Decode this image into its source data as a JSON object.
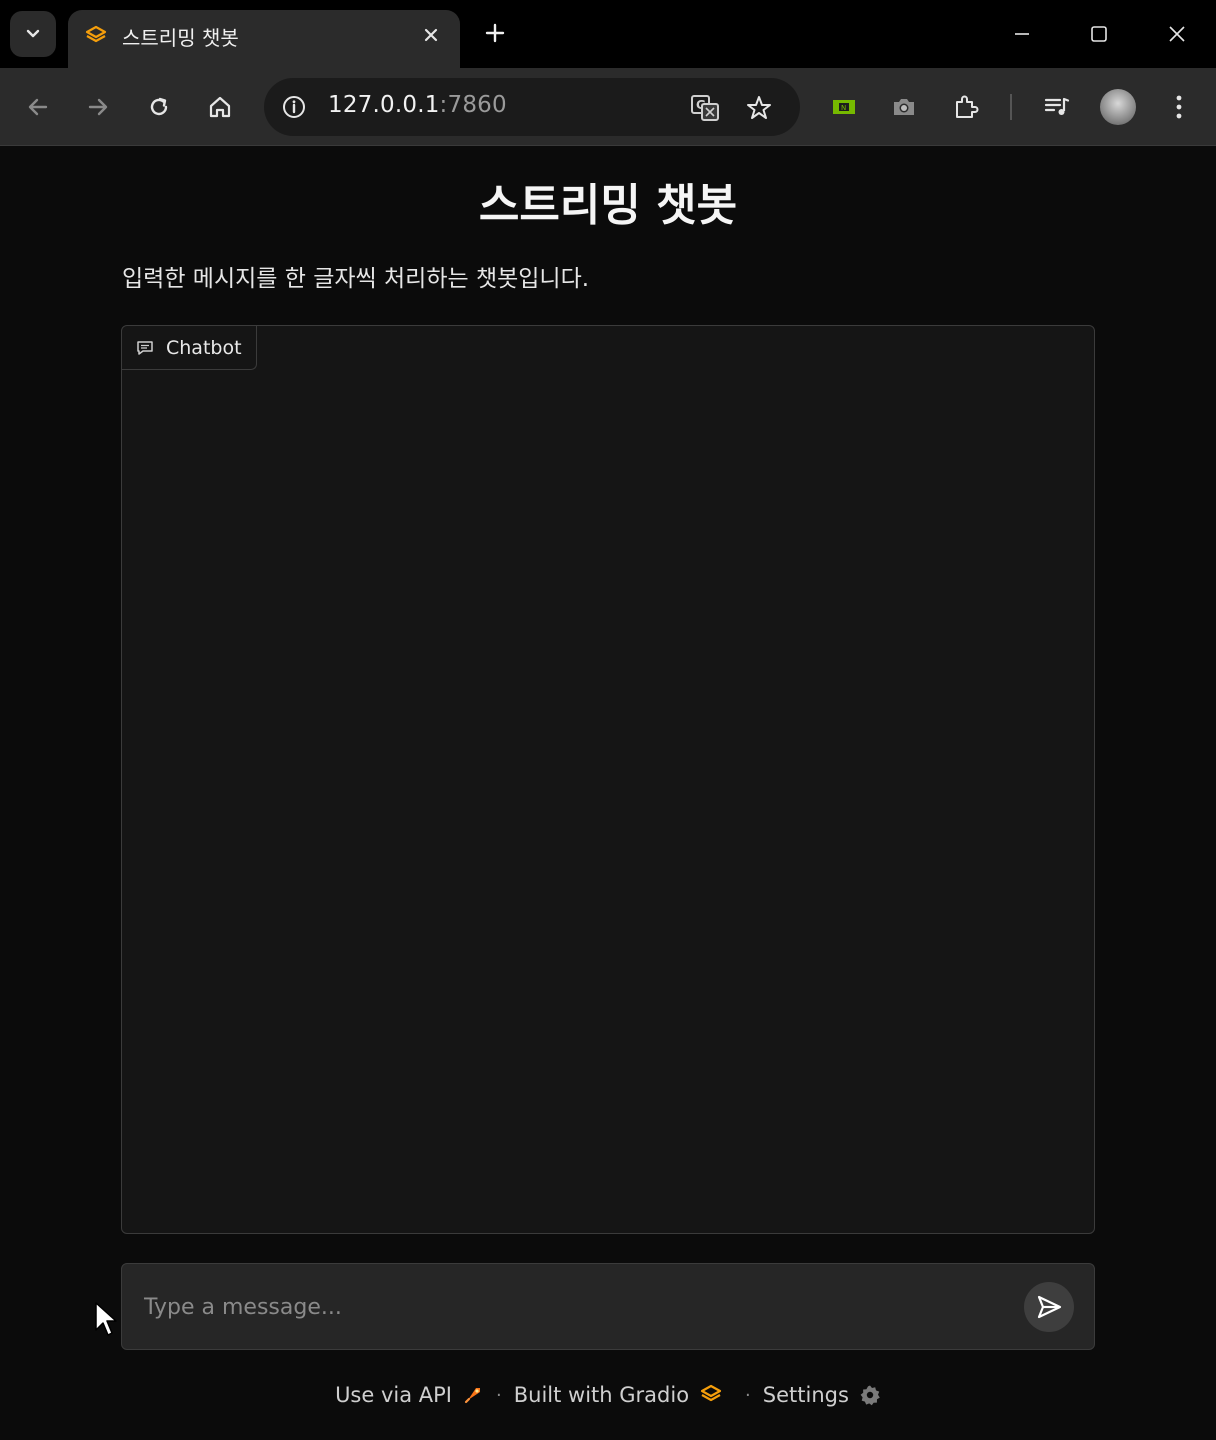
{
  "browser": {
    "tab_title": "스트리밍 챗봇",
    "url_host": "127.0.0.1",
    "url_port": ":7860"
  },
  "page": {
    "title": "스트리밍 챗봇",
    "description": "입력한 메시지를 한 글자씩 처리하는 챗봇입니다."
  },
  "chatbot": {
    "label": "Chatbot"
  },
  "input": {
    "placeholder": "Type a message...",
    "value": ""
  },
  "footer": {
    "api_label": "Use via API",
    "built_label": "Built with Gradio",
    "settings_label": "Settings",
    "separator": "·"
  },
  "colors": {
    "gradio_orange": "#f59e0b",
    "page_bg": "#0b0b0b",
    "panel_bg": "#151515"
  }
}
